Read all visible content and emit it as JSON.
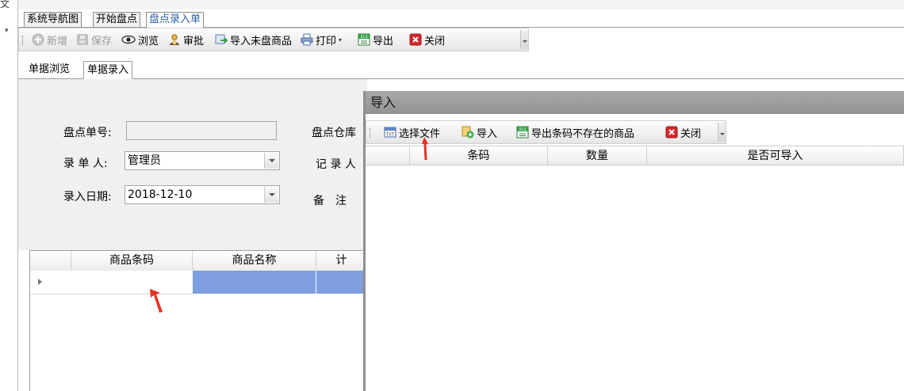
{
  "gutter": {
    "top_text": "文"
  },
  "tabs": [
    {
      "label": "系统导航图",
      "active": false
    },
    {
      "label": "开始盘点",
      "active": false
    },
    {
      "label": "盘点录入单",
      "active": true
    }
  ],
  "toolbar": {
    "items": [
      {
        "label": "新增",
        "icon": "plus-circle-icon",
        "disabled": true
      },
      {
        "label": "保存",
        "icon": "save-icon",
        "disabled": true
      },
      {
        "label": "浏览",
        "icon": "eye-icon",
        "disabled": false
      },
      {
        "label": "审批",
        "icon": "user-approve-icon",
        "disabled": false
      },
      {
        "label": "导入未盘商品",
        "icon": "import-icon",
        "disabled": false
      },
      {
        "label": "打印",
        "icon": "printer-icon",
        "disabled": false
      },
      {
        "label": "导出",
        "icon": "export-xls-icon",
        "disabled": false
      },
      {
        "label": "关闭",
        "icon": "close-red-icon",
        "disabled": false
      }
    ]
  },
  "subtabs": [
    {
      "label": "单据浏览",
      "active": false
    },
    {
      "label": "单据录入",
      "active": true
    }
  ],
  "form": {
    "order_no_label": "盘点单号:",
    "order_no_value": "",
    "warehouse_label": "盘点仓库",
    "recorder_label": "录 单 人:",
    "recorder_value": "管理员",
    "record_person_label": "记 录 人",
    "date_label": "录入日期:",
    "date_value": "2018-12-10",
    "remark_label": "备　注"
  },
  "grid": {
    "columns": [
      "商品条码",
      "商品名称",
      "计"
    ]
  },
  "dialog": {
    "title": "导入",
    "toolbar": [
      {
        "label": "选择文件",
        "icon": "txt-file-icon"
      },
      {
        "label": "导入",
        "icon": "import-add-icon"
      },
      {
        "label": "导出条码不存在的商品",
        "icon": "export-xls-icon"
      },
      {
        "label": "关闭",
        "icon": "close-red-icon"
      }
    ],
    "columns": [
      "条码",
      "数量",
      "是否可导入"
    ]
  },
  "colors": {
    "accent": "#2b5fa8",
    "selected_cell": "#7f9ee0",
    "annotation_arrow": "#e53222",
    "form_bg": "#f0f0f0"
  }
}
